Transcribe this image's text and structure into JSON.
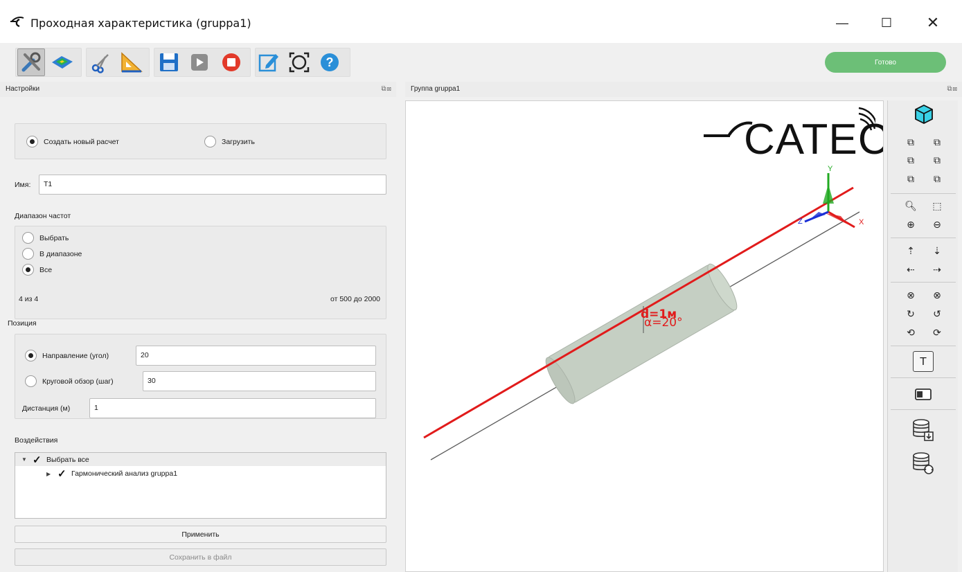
{
  "window": {
    "title": "Проходная характеристика (gruppa1)",
    "minimize": "—",
    "maximize": "☐",
    "close": "✕"
  },
  "toolbar": {
    "status": "Готово",
    "status_color": "#6cbf77",
    "icons": [
      "settings-tools-icon",
      "surface-plot-icon",
      "scissors-icon",
      "triangle-ruler-icon",
      "save-icon",
      "play-icon",
      "stop-icon",
      "edit-icon",
      "fit-selection-icon",
      "help-icon"
    ]
  },
  "settings_panel": {
    "title": "Настройки",
    "mode": {
      "create_label": "Создать новый расчет",
      "load_label": "Загрузить",
      "selected": "create"
    },
    "name": {
      "label": "Имя:",
      "value": "T1"
    },
    "frequency": {
      "title": "Диапазон частот",
      "options": [
        "Выбрать",
        "В диапазоне",
        "Все"
      ],
      "selected": "Все",
      "count": "4 из 4",
      "range": "от 500 до 2000"
    },
    "position": {
      "title": "Позиция",
      "direction_label": "Направление (угол)",
      "direction_value": "20",
      "circular_label": "Круговой обзор (шаг)",
      "circular_value": "30",
      "distance_label": "Дистанция (м)",
      "distance_value": "1",
      "selected": "direction"
    },
    "actions": {
      "title": "Воздействия",
      "select_all": "Выбрать все",
      "items": [
        "Гармонический анализ gruppa1"
      ]
    },
    "apply_label": "Применить",
    "save_label": "Сохранить в файл"
  },
  "view_panel": {
    "title": "Группа gruppa1",
    "logo_text": "CATEC",
    "annotation_distance": "d=1м",
    "annotation_angle": "α=20°",
    "axes": {
      "x": "X",
      "y": "Y",
      "z": "Z"
    },
    "colors": {
      "ray": "#e11b1b",
      "cylinder": "#c5cfc3",
      "x_axis": "#e11b1b",
      "y_axis": "#22aa22",
      "z_axis": "#1a2fd6"
    }
  },
  "side_toolbar": {
    "icons": [
      "view-3d-cube-icon",
      "view-front-icon",
      "view-back-icon",
      "view-left-icon",
      "view-right-icon",
      "view-top-icon",
      "view-bottom-icon",
      "zoom-fit-icon",
      "zoom-window-icon",
      "zoom-in-icon",
      "zoom-out-icon",
      "pan-up-icon",
      "pan-down-icon",
      "pan-left-icon",
      "pan-right-icon",
      "rotate-x-minus-icon",
      "rotate-x-plus-icon",
      "rotate-y-minus-icon",
      "rotate-y-plus-icon",
      "rotate-z-minus-icon",
      "rotate-z-plus-icon",
      "text-label-icon",
      "screenshot-icon",
      "database-import-icon",
      "database-refresh-icon"
    ],
    "text_glyph": "T"
  }
}
